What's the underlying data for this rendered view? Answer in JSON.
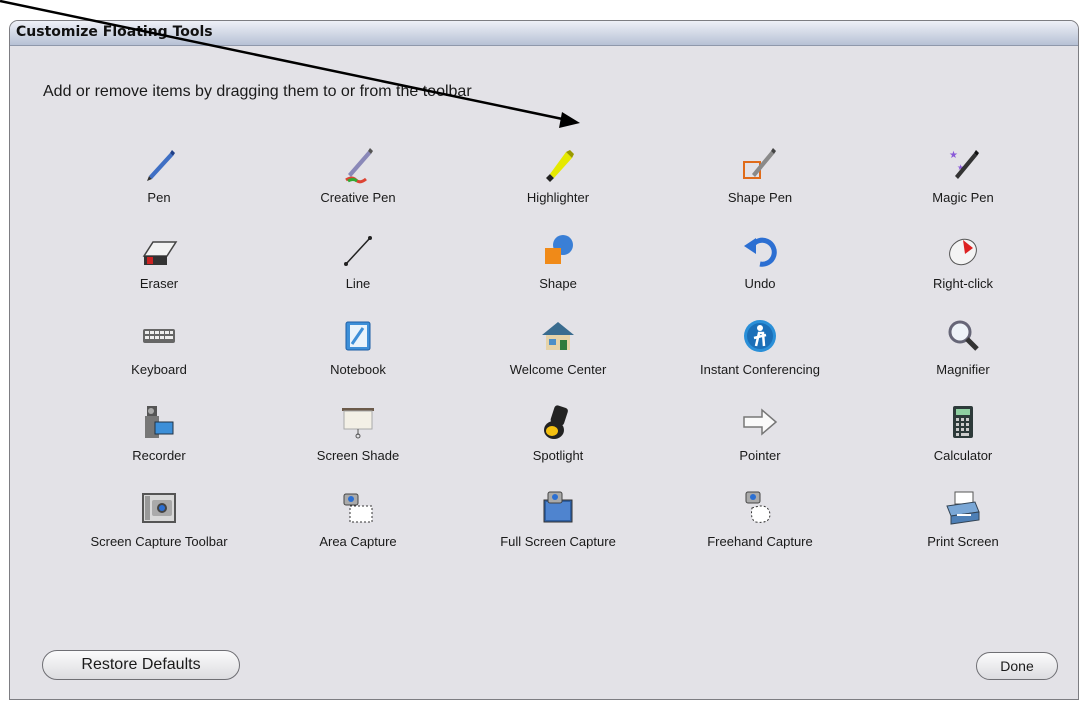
{
  "window": {
    "title": "Customize Floating Tools"
  },
  "instruction": "Add or remove items by dragging them to or from the toolbar",
  "tools": [
    {
      "label": "Pen",
      "icon": "pen-icon"
    },
    {
      "label": "Creative Pen",
      "icon": "creative-pen-icon"
    },
    {
      "label": "Highlighter",
      "icon": "highlighter-icon"
    },
    {
      "label": "Shape Pen",
      "icon": "shape-pen-icon"
    },
    {
      "label": "Magic Pen",
      "icon": "magic-pen-icon"
    },
    {
      "label": "Eraser",
      "icon": "eraser-icon"
    },
    {
      "label": "Line",
      "icon": "line-icon"
    },
    {
      "label": "Shape",
      "icon": "shape-icon"
    },
    {
      "label": "Undo",
      "icon": "undo-icon"
    },
    {
      "label": "Right-click",
      "icon": "right-click-icon"
    },
    {
      "label": "Keyboard",
      "icon": "keyboard-icon"
    },
    {
      "label": "Notebook",
      "icon": "notebook-icon"
    },
    {
      "label": "Welcome Center",
      "icon": "welcome-center-icon"
    },
    {
      "label": "Instant Conferencing",
      "icon": "instant-conferencing-icon"
    },
    {
      "label": "Magnifier",
      "icon": "magnifier-icon"
    },
    {
      "label": "Recorder",
      "icon": "recorder-icon"
    },
    {
      "label": "Screen Shade",
      "icon": "screen-shade-icon"
    },
    {
      "label": "Spotlight",
      "icon": "spotlight-icon"
    },
    {
      "label": "Pointer",
      "icon": "pointer-icon"
    },
    {
      "label": "Calculator",
      "icon": "calculator-icon"
    },
    {
      "label": "Screen Capture Toolbar",
      "icon": "screen-capture-toolbar-icon"
    },
    {
      "label": "Area Capture",
      "icon": "area-capture-icon"
    },
    {
      "label": "Full Screen Capture",
      "icon": "full-screen-capture-icon"
    },
    {
      "label": "Freehand Capture",
      "icon": "freehand-capture-icon"
    },
    {
      "label": "Print Screen",
      "icon": "print-screen-icon"
    }
  ],
  "buttons": {
    "restore": "Restore Defaults",
    "done": "Done"
  },
  "colors": {
    "dialog_bg": "#e3e2e7",
    "titlebar_top": "#eef0f7",
    "titlebar_bottom": "#b7c1d5"
  }
}
